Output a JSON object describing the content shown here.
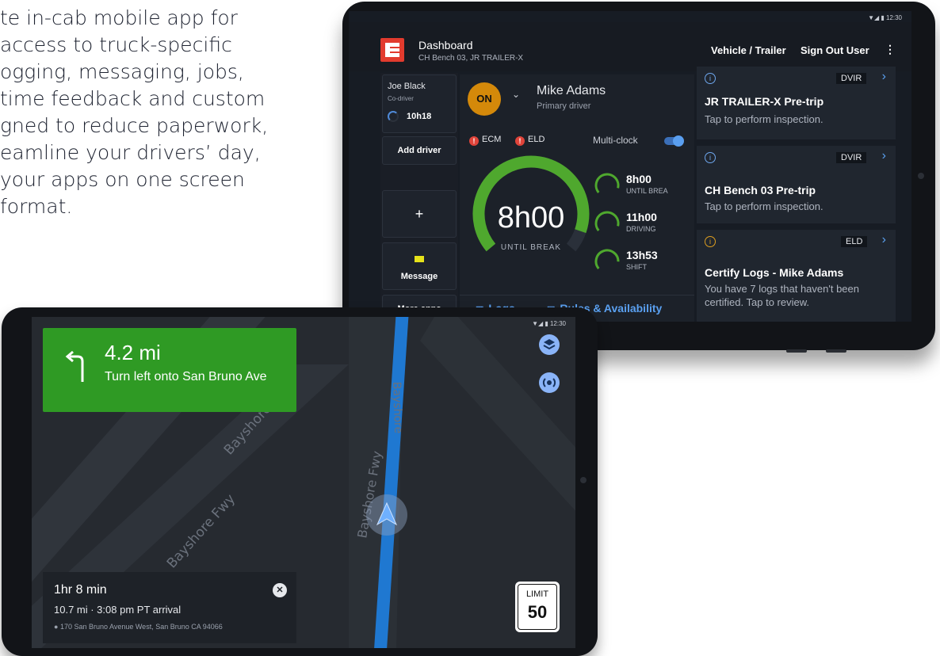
{
  "marketing": {
    "lines": [
      "te in-cab mobile app for",
      "access to truck-specific",
      "ogging, messaging, jobs,",
      "time feedback and custom",
      "gned to reduce paperwork,",
      "eamline your drivers’ day,",
      " your apps on one screen",
      "format."
    ]
  },
  "dashboard": {
    "status_bar": "▼◢ ▮ 12:30",
    "header": {
      "title": "Dashboard",
      "subtitle": "CH Bench 03, JR TRAILER-X",
      "vehicle_trailer": "Vehicle / Trailer",
      "sign_out": "Sign Out User",
      "more_icon": "more-vert-icon"
    },
    "left": {
      "codriver_name": "Joe Black",
      "codriver_role": "Co-driver",
      "codriver_time": "10h18",
      "add_driver": "Add driver",
      "add_icon": "+",
      "message": "Message",
      "more_apps": "More apps"
    },
    "driver": {
      "status": "ON",
      "name": "Mike Adams",
      "role": "Primary driver",
      "flags": [
        "ECM",
        "ELD"
      ],
      "multi_clock": "Multi-clock",
      "multi_clock_on": true,
      "main_time": "8h00",
      "main_label": "UNTIL BREAK",
      "main_progress": 0.92,
      "clocks": [
        {
          "time": "8h00",
          "label": "UNTIL BREA",
          "progress": 0.9
        },
        {
          "time": "11h00",
          "label": "DRIVING",
          "progress": 0.9
        },
        {
          "time": "13h53",
          "label": "SHIFT",
          "progress": 0.85
        }
      ],
      "tabs": [
        "Logs",
        "Rules & Availability"
      ]
    },
    "cards": [
      {
        "tag": "DVIR",
        "title": "JR TRAILER-X Pre-trip",
        "text": "Tap to perform inspection.",
        "icon_color": "#6fa8f0"
      },
      {
        "tag": "DVIR",
        "title": "CH Bench 03 Pre-trip",
        "text": "Tap to perform inspection.",
        "icon_color": "#6fa8f0"
      },
      {
        "tag": "ELD",
        "title": "Certify Logs - Mike Adams",
        "text": "You have 7 logs that haven't been certified. Tap to review.",
        "icon_color": "#e0a020"
      }
    ],
    "colors": {
      "accent": "#5aa0f0",
      "clock_green": "#4fa82e",
      "on_status": "#d4890a",
      "logo": "#e23b2e"
    }
  },
  "navigation": {
    "status_bar": "▼◢ ▮ 12:30",
    "instruction": {
      "distance": "4.2 mi",
      "text": "Turn left onto San Bruno Ave",
      "icon": "turn-left-arrow-icon"
    },
    "map_labels": [
      "Bayshore",
      "Bayshore",
      "Bayshore Fwy",
      "Bayshore Fwy"
    ],
    "eta": {
      "duration": "1hr 8 min",
      "summary": "10.7 mi · 3:08 pm PT arrival",
      "address": "170 San Bruno Avenue West, San Bruno CA 94066"
    },
    "speed_limit": {
      "label": "LIMIT",
      "value": "50"
    },
    "buttons": [
      "layers-icon",
      "broadcast-icon"
    ],
    "colors": {
      "banner": "#2f9a24",
      "route": "#1f78d1"
    }
  }
}
